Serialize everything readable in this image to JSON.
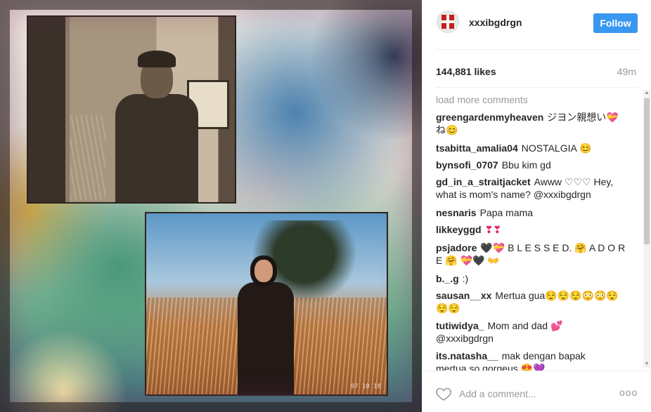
{
  "post": {
    "username": "xxxibgdrgn",
    "follow_label": "Follow",
    "likes": "144,881 likes",
    "time": "49m",
    "load_more": "load more comments",
    "comment_placeholder": "Add a comment...",
    "more_options": "ooo"
  },
  "comments": [
    {
      "user": "greengardenmyheaven",
      "text": "ジヨン親想い💝",
      "line2": "ね😊"
    },
    {
      "user": "tsabitta_amalia04",
      "text": "NOSTALGIA 😊"
    },
    {
      "user": "bynsofi_0707",
      "text": "Bbu kim gd"
    },
    {
      "user": "gd_in_a_straitjacket",
      "text": "Awww ♡♡♡ Hey,",
      "line2": "what is mom's name? @xxxibgdrgn"
    },
    {
      "user": "nesnaris",
      "text": "Papa mama"
    },
    {
      "user": "likkeyggd",
      "text": "❣❣"
    },
    {
      "user": "psjadore",
      "text": "🖤💝 B L E S S E D. 🤗 A D O R",
      "line2": "E 🤗 💝🖤 👐"
    },
    {
      "user": "b._.g",
      "text": ":)"
    },
    {
      "user": "sausan__xx",
      "text": "Mertua gua😌😌😌😳😳😌",
      "line2": "😌😌"
    },
    {
      "user": "tutiwidya_",
      "text": "Mom and dad 💕",
      "line2": "@xxxibgdrgn"
    },
    {
      "user": "its.natasha__",
      "text": "mak dengan bapak",
      "line2": "mertua so gorgeus 😍💜"
    }
  ],
  "photo": {
    "stamp": "97 10 18"
  },
  "colors": {
    "follow_button": "#3897f0",
    "muted_text": "#999999",
    "divider": "#efefef"
  }
}
